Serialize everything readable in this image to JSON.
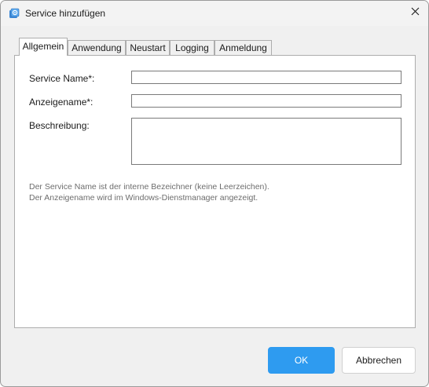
{
  "window": {
    "title": "Service hinzufügen",
    "icon": "service-gear-icon",
    "close_icon": "close-icon"
  },
  "tabs": [
    {
      "label": "Allgemein",
      "active": true
    },
    {
      "label": "Anwendung",
      "active": false
    },
    {
      "label": "Neustart",
      "active": false
    },
    {
      "label": "Logging",
      "active": false
    },
    {
      "label": "Anmeldung",
      "active": false
    }
  ],
  "form": {
    "service_name_label": "Service Name*:",
    "service_name_value": "",
    "display_name_label": "Anzeigename*:",
    "display_name_value": "",
    "description_label": "Beschreibung:",
    "description_value": "",
    "hint_line1": "Der Service Name ist der interne Bezeichner (keine Leerzeichen).",
    "hint_line2": "Der Anzeigename wird im Windows-Dienstmanager angezeigt."
  },
  "buttons": {
    "ok_label": "OK",
    "cancel_label": "Abbrechen"
  },
  "colors": {
    "accent": "#2e9bf0",
    "window_bg": "#f0f0f0",
    "panel_bg": "#ffffff"
  }
}
